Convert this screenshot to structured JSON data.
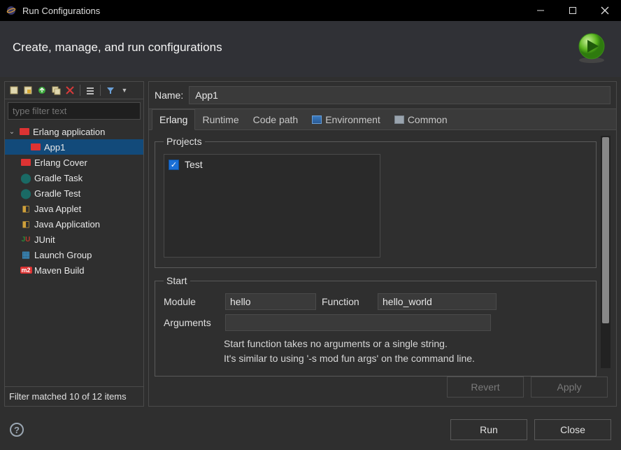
{
  "window": {
    "title": "Run Configurations"
  },
  "header": {
    "title": "Create, manage, and run configurations"
  },
  "left": {
    "filter_placeholder": "type filter text",
    "status": "Filter matched 10 of 12 items",
    "tree": {
      "root_label": "Erlang application",
      "app_label": "App1",
      "items": [
        "Erlang Cover",
        "Gradle Task",
        "Gradle Test",
        "Java Applet",
        "Java Application",
        "JUnit",
        "Launch Group",
        "Maven Build"
      ]
    }
  },
  "right": {
    "name_label": "Name:",
    "name_value": "App1",
    "tabs": {
      "erlang": "Erlang",
      "runtime": "Runtime",
      "codepath": "Code path",
      "environment": "Environment",
      "common": "Common"
    },
    "projects": {
      "legend": "Projects",
      "item": "Test"
    },
    "start": {
      "legend": "Start",
      "module_label": "Module",
      "module_value": "hello",
      "function_label": "Function",
      "function_value": "hello_world",
      "arguments_label": "Arguments",
      "arguments_value": "",
      "hint1": "Start function takes no arguments or a single string.",
      "hint2": "It's similar to using '-s mod fun args' on the command line."
    },
    "buttons": {
      "revert": "Revert",
      "apply": "Apply"
    }
  },
  "footer": {
    "run": "Run",
    "close": "Close"
  }
}
